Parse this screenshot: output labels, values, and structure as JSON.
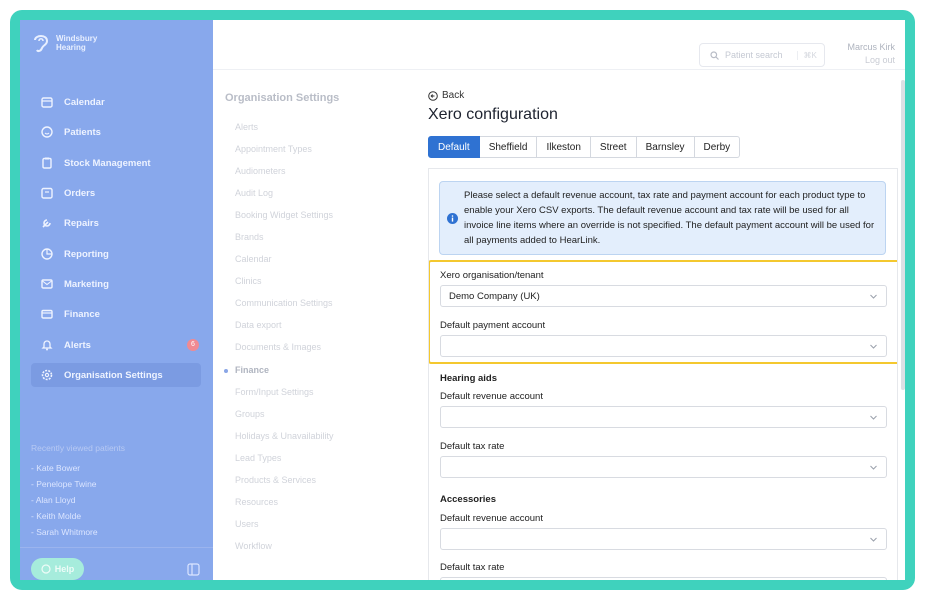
{
  "brand": {
    "name_line1": "Windsbury",
    "name_line2": "Hearing"
  },
  "sidebar": {
    "items": [
      {
        "label": "Calendar",
        "icon": "calendar-icon"
      },
      {
        "label": "Patients",
        "icon": "smile-icon"
      },
      {
        "label": "Stock Management",
        "icon": "clipboard-icon"
      },
      {
        "label": "Orders",
        "icon": "orders-icon"
      },
      {
        "label": "Repairs",
        "icon": "wrench-icon"
      },
      {
        "label": "Reporting",
        "icon": "pie-chart-icon"
      },
      {
        "label": "Marketing",
        "icon": "mail-icon"
      },
      {
        "label": "Finance",
        "icon": "card-icon"
      },
      {
        "label": "Alerts",
        "icon": "bell-icon",
        "badge": "6"
      },
      {
        "label": "Organisation Settings",
        "icon": "gear-icon",
        "active": true
      }
    ],
    "recent_title": "Recently viewed patients",
    "recent": [
      "- Kate Bower",
      "- Penelope Twine",
      "- Alan Lloyd",
      "- Keith Molde",
      "- Sarah Whitmore"
    ],
    "help_label": "Help"
  },
  "header": {
    "search_placeholder": "Patient search",
    "search_shortcut": "⌘K",
    "user_name": "Marcus Kirk",
    "logout_label": "Log out"
  },
  "settings_nav": {
    "title": "Organisation Settings",
    "items": [
      "Alerts",
      "Appointment Types",
      "Audiometers",
      "Audit Log",
      "Booking Widget Settings",
      "Brands",
      "Calendar",
      "Clinics",
      "Communication Settings",
      "Data export",
      "Documents & Images",
      "Finance",
      "Form/Input Settings",
      "Groups",
      "Holidays & Unavailability",
      "Lead Types",
      "Products & Services",
      "Resources",
      "Users",
      "Workflow"
    ],
    "current": "Finance"
  },
  "page": {
    "back_label": "Back",
    "title": "Xero configuration",
    "tabs": [
      "Default",
      "Sheffield",
      "Ilkeston",
      "Street",
      "Barnsley",
      "Derby"
    ],
    "active_tab": "Default",
    "info_text": "Please select a default revenue account, tax rate and payment account for each product type to enable your Xero CSV exports. The default revenue account and tax rate will be used for all invoice line items where an override is not specified. The default payment account will be used for all payments added to HearLink.",
    "tenant_label": "Xero organisation/tenant",
    "tenant_value": "Demo Company (UK)",
    "payment_label": "Default payment account",
    "payment_value": "",
    "sections": [
      {
        "title": "Hearing aids",
        "revenue_label": "Default revenue account",
        "revenue_value": "",
        "tax_label": "Default tax rate",
        "tax_value": ""
      },
      {
        "title": "Accessories",
        "revenue_label": "Default revenue account",
        "revenue_value": "",
        "tax_label": "Default tax rate",
        "tax_value": ""
      }
    ]
  },
  "colors": {
    "frame": "#3fd2bd",
    "sidebar": "#88a8ec",
    "primary": "#2f72d2",
    "highlight": "#f4c82f",
    "info_bg": "#e3eefc"
  }
}
